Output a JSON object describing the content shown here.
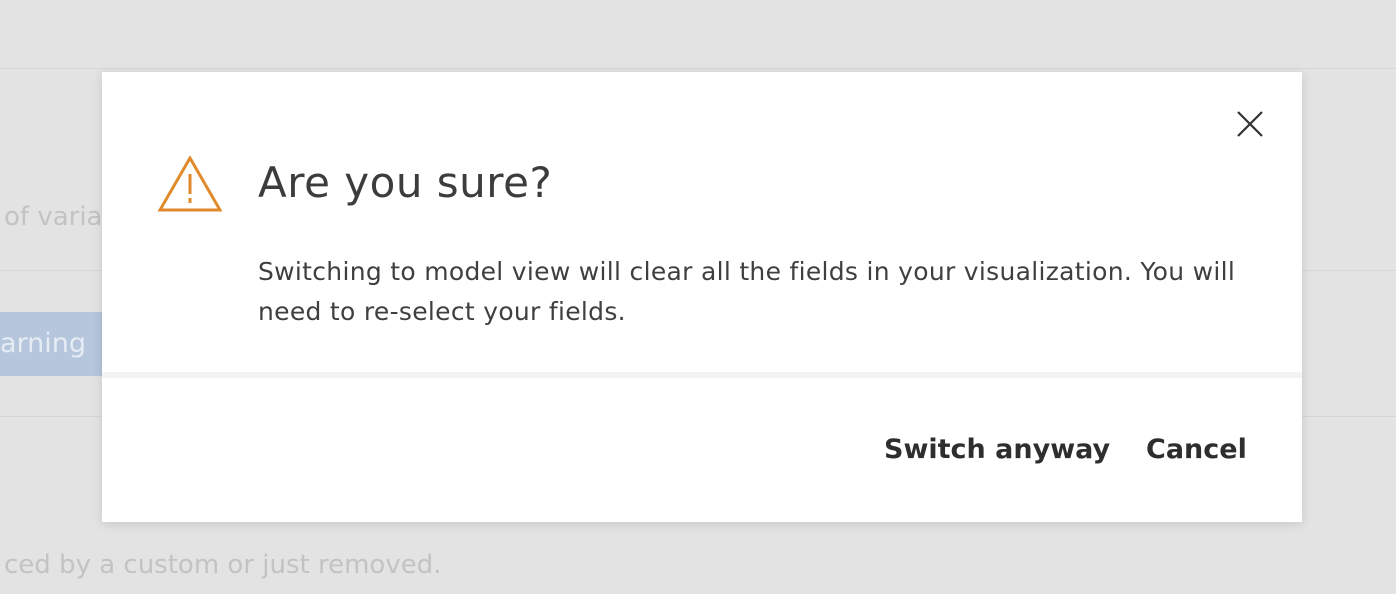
{
  "background": {
    "text_1": "of varia",
    "tag_label": "arning",
    "text_2": "ced by a custom or just removed."
  },
  "dialog": {
    "title": "Are you sure?",
    "message": "Switching to model view will clear all the fields in your visualization. You will need to re-select your fields.",
    "warning_icon": "warning-triangle-icon",
    "warning_color": "#e08a2c",
    "close_icon": "close-icon",
    "confirm_label": "Switch anyway",
    "cancel_label": "Cancel"
  }
}
